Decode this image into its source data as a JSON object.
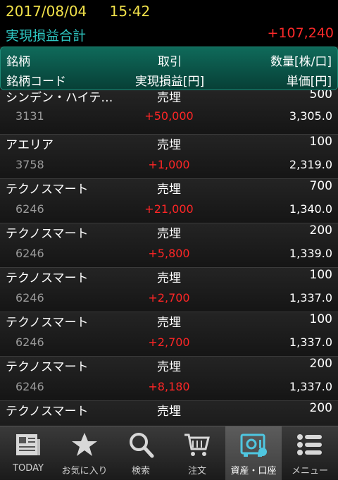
{
  "status": {
    "date": "2017/08/04",
    "time": "15:42"
  },
  "summary": {
    "label": "実現損益合計",
    "value": "+107,240"
  },
  "header": {
    "col1_row1": "銘柄",
    "col2_row1": "取引",
    "col3_row1": "数量[株/口]",
    "col1_row2": "銘柄コード",
    "col2_row2": "実現損益[円]",
    "col3_row2": "単価[円]"
  },
  "rows": [
    {
      "name": "シンデン・ハイテ…",
      "trade": "売埋",
      "qty": "500",
      "code": "3131",
      "pl": "+50,000",
      "price": "3,305.0"
    },
    {
      "name": "アエリア",
      "trade": "売埋",
      "qty": "100",
      "code": "3758",
      "pl": "+1,000",
      "price": "2,319.0"
    },
    {
      "name": "テクノスマート",
      "trade": "売埋",
      "qty": "700",
      "code": "6246",
      "pl": "+21,000",
      "price": "1,340.0"
    },
    {
      "name": "テクノスマート",
      "trade": "売埋",
      "qty": "200",
      "code": "6246",
      "pl": "+5,800",
      "price": "1,339.0"
    },
    {
      "name": "テクノスマート",
      "trade": "売埋",
      "qty": "100",
      "code": "6246",
      "pl": "+2,700",
      "price": "1,337.0"
    },
    {
      "name": "テクノスマート",
      "trade": "売埋",
      "qty": "100",
      "code": "6246",
      "pl": "+2,700",
      "price": "1,337.0"
    },
    {
      "name": "テクノスマート",
      "trade": "売埋",
      "qty": "200",
      "code": "6246",
      "pl": "+8,180",
      "price": "1,337.0"
    },
    {
      "name": "テクノスマート",
      "trade": "売埋",
      "qty": "200",
      "code": "",
      "pl": "",
      "price": ""
    }
  ],
  "tabs": [
    {
      "label": "TODAY",
      "icon": "newspaper-icon"
    },
    {
      "label": "お気に入り",
      "icon": "star-icon"
    },
    {
      "label": "検索",
      "icon": "search-icon"
    },
    {
      "label": "注文",
      "icon": "cart-icon"
    },
    {
      "label": "資産・口座",
      "icon": "safe-icon",
      "active": true
    },
    {
      "label": "メニュー",
      "icon": "menu-icon"
    }
  ],
  "colors": {
    "accent": "#2ec7c2",
    "loss_gain": "#ff2626",
    "status": "#f1e14a"
  }
}
